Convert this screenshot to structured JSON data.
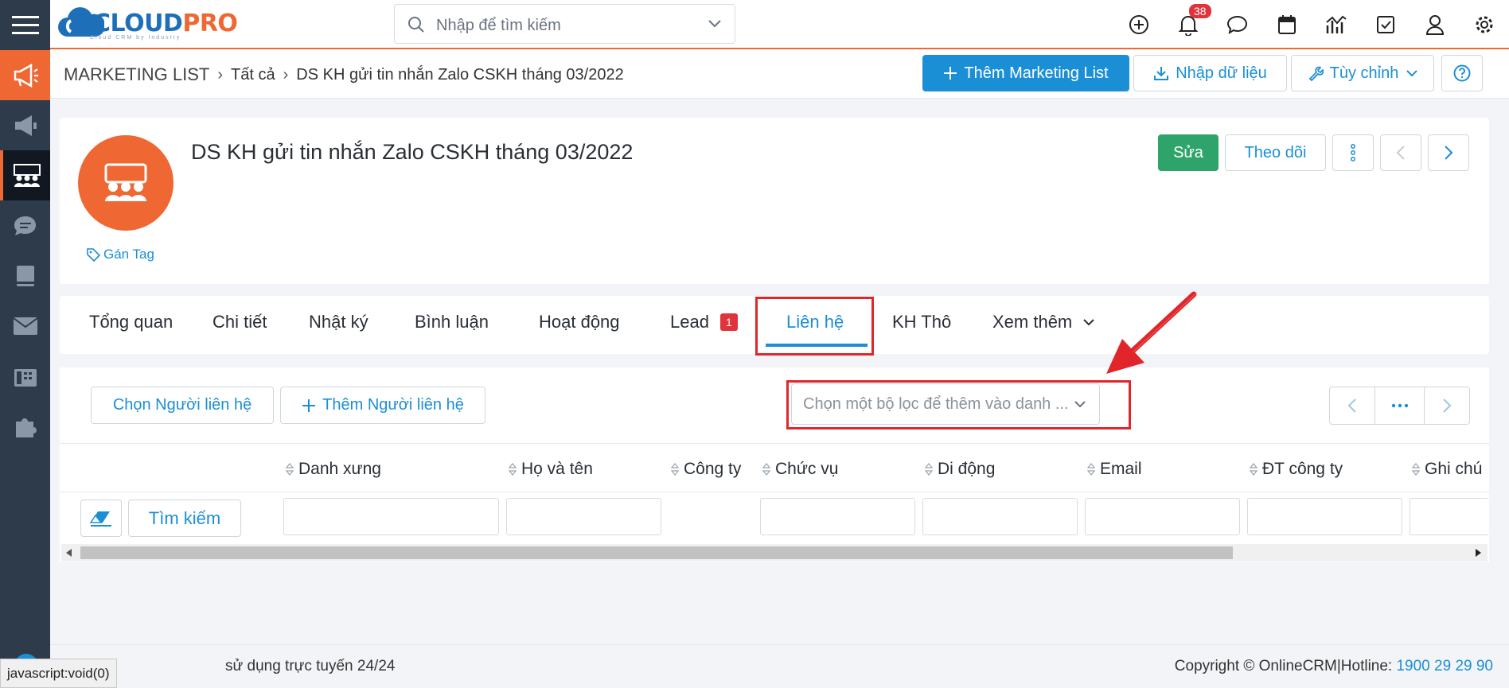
{
  "sidebar": {
    "items": [
      {
        "icon": "menu-icon"
      },
      {
        "icon": "megaphone-icon"
      },
      {
        "icon": "campaign-icon"
      },
      {
        "icon": "group-icon"
      },
      {
        "icon": "chat-icon"
      },
      {
        "icon": "book-icon"
      },
      {
        "icon": "mail-icon"
      },
      {
        "icon": "fax-icon"
      },
      {
        "icon": "puzzle-icon"
      }
    ]
  },
  "header": {
    "logo_main": "CLOUD",
    "logo_accent": "PRO",
    "logo_sub": "Cloud CRM by Industry",
    "search_placeholder": "Nhập để tìm kiếm",
    "notification_count": "38"
  },
  "breadcrumb": {
    "root": "MARKETING LIST",
    "all": "Tất cả",
    "current": "DS KH gửi tin nhắn Zalo CSKH tháng 03/2022"
  },
  "actions": {
    "add_label": "Thêm Marketing List",
    "import_label": "Nhập dữ liệu",
    "customize_label": "Tùy chỉnh"
  },
  "record": {
    "title": "DS KH gửi tin nhắn Zalo CSKH tháng 03/2022",
    "tag_label": "Gán Tag",
    "edit_label": "Sửa",
    "follow_label": "Theo dõi"
  },
  "tabs": [
    {
      "label": "Tổng quan"
    },
    {
      "label": "Chi tiết"
    },
    {
      "label": "Nhật ký"
    },
    {
      "label": "Bình luận"
    },
    {
      "label": "Hoạt động"
    },
    {
      "label": "Lead",
      "badge": "1"
    },
    {
      "label": "Liên hệ",
      "active": true
    },
    {
      "label": "KH Thô"
    },
    {
      "label": "Xem thêm"
    }
  ],
  "related": {
    "select_contact_label": "Chọn Người liên hệ",
    "add_contact_label": "Thêm Người liên hệ",
    "filter_placeholder": "Chọn một bộ lọc để thêm vào danh ...",
    "search_label": "Tìm kiếm",
    "columns": [
      "Danh xưng",
      "Họ và tên",
      "Công ty",
      "Chức vụ",
      "Di động",
      "Email",
      "ĐT công ty",
      "Ghi chú"
    ]
  },
  "footer": {
    "support_text": "sử dụng trực tuyến 24/24",
    "copyright": "Copyright © OnlineCRM|Hotline: ",
    "hotline": "1900 29 29 90",
    "status_url": "javascript:void(0)"
  },
  "colors": {
    "brand_orange": "#ef6733",
    "brand_blue": "#1b8fd6",
    "sidebar": "#2d3b4b",
    "success": "#2fa46a",
    "highlight_red": "#e0262b"
  }
}
